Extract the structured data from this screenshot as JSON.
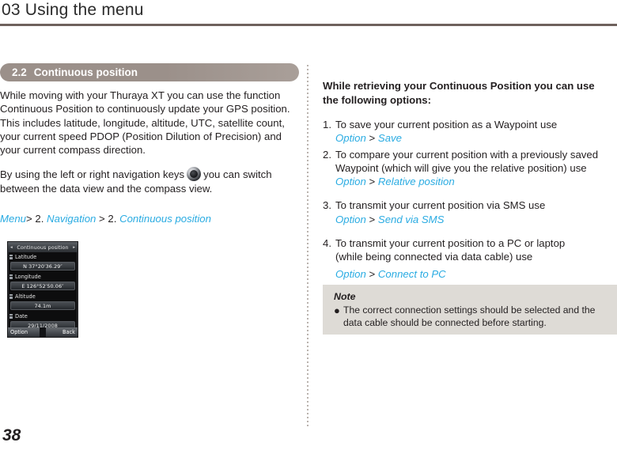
{
  "header": {
    "chapter_label": "03 Using the menu",
    "rule_color": "#6e615c"
  },
  "left_column": {
    "section": {
      "number": "2.2",
      "title": "Continuous position",
      "pill_color": "#9b908a"
    },
    "paragraph_1_part_1": "While moving with your Thuraya XT you can use the function Continuous Position to continuously update your GPS position. This includes latitude, longitude, altitude, UTC, satellite count, your current speed PDOP (Position Dilution of Precision) and your current compass direction.",
    "paragraph_2_before_icon": "By using the left or right navigation keys",
    "paragraph_2_after_icon": "you can switch between the data view and the compass view.",
    "breadcrumb": {
      "root": "Menu",
      "sep1": ">",
      "index1": "2.",
      "item1": "Navigation",
      "sep2": ">",
      "index2": "2.",
      "item2": "Continuous position"
    },
    "lcd": {
      "title": "Continuous position",
      "arrow_left": "◂",
      "arrow_right": "▸",
      "fields": [
        {
          "label": "Latitude",
          "value": "N 37°20′36.29″"
        },
        {
          "label": "Longitude",
          "value": "E 126°52′50.06″"
        },
        {
          "label": "Altitude",
          "value": "74.1m"
        },
        {
          "label": "Date",
          "value": "29/11/2008"
        }
      ],
      "softkey_left": "Option",
      "softkey_right": "Back"
    }
  },
  "right_column": {
    "heading": "While retrieving your Continuous Position you can use the following options:",
    "options": [
      {
        "marker": "1.",
        "text": "To save your current position as a Waypoint use",
        "path_root": "Option",
        "path_sep": ">",
        "path_target": "Save"
      },
      {
        "marker": "2.",
        "text": "To compare your current position with a previously saved Waypoint (which will give you the relative position) use",
        "path_root": "Option",
        "path_sep": ">",
        "path_target": "Relative position"
      },
      {
        "marker": "3.",
        "text": "To transmit your current position via SMS use",
        "path_root": "Option",
        "path_sep": ">",
        "path_target": "Send via SMS"
      },
      {
        "marker": "4.",
        "text": "To transmit your current position to a PC or laptop",
        "text_line2": "(while being connected via data cable) use",
        "path_root": "Option",
        "path_sep": ">",
        "path_target": "Connect to PC"
      }
    ],
    "note": {
      "title": "Note",
      "bullet": "●",
      "text": "The correct connection settings should be selected and the data cable should be connected before starting.",
      "background": "#dedbd6"
    }
  },
  "footer": {
    "page_number": "38"
  },
  "accent_color": "#29abe2"
}
